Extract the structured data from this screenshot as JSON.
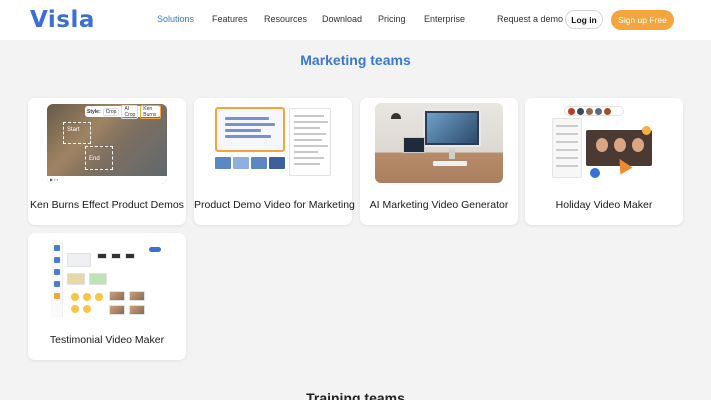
{
  "header": {
    "logo": "Visla",
    "nav": [
      "Solutions",
      "Features",
      "Resources",
      "Download",
      "Pricing",
      "Enterprise"
    ],
    "active_nav": "Solutions",
    "request_demo": "Request a demo",
    "login": "Log in",
    "signup": "Sign up Free"
  },
  "sections": {
    "marketing_title": "Marketing teams",
    "training_title": "Training teams"
  },
  "cards": [
    {
      "title": "Ken Burns Effect Product Demos"
    },
    {
      "title": "Product Demo Video for Marketing"
    },
    {
      "title": "AI Marketing Video Generator"
    },
    {
      "title": "Holiday Video Maker"
    },
    {
      "title": "Testimonial Video Maker"
    }
  ],
  "thumb_text": {
    "kb_style_label": "Style:",
    "kb_options": [
      "Crop",
      "AI Crop",
      "Ken Burns"
    ],
    "kb_start": "Start",
    "kb_end": "End"
  },
  "colors": {
    "brand": "#3b6fd6",
    "accent": "#f5a53e",
    "active_nav": "#3a78d6",
    "background": "#f3f3f3"
  }
}
